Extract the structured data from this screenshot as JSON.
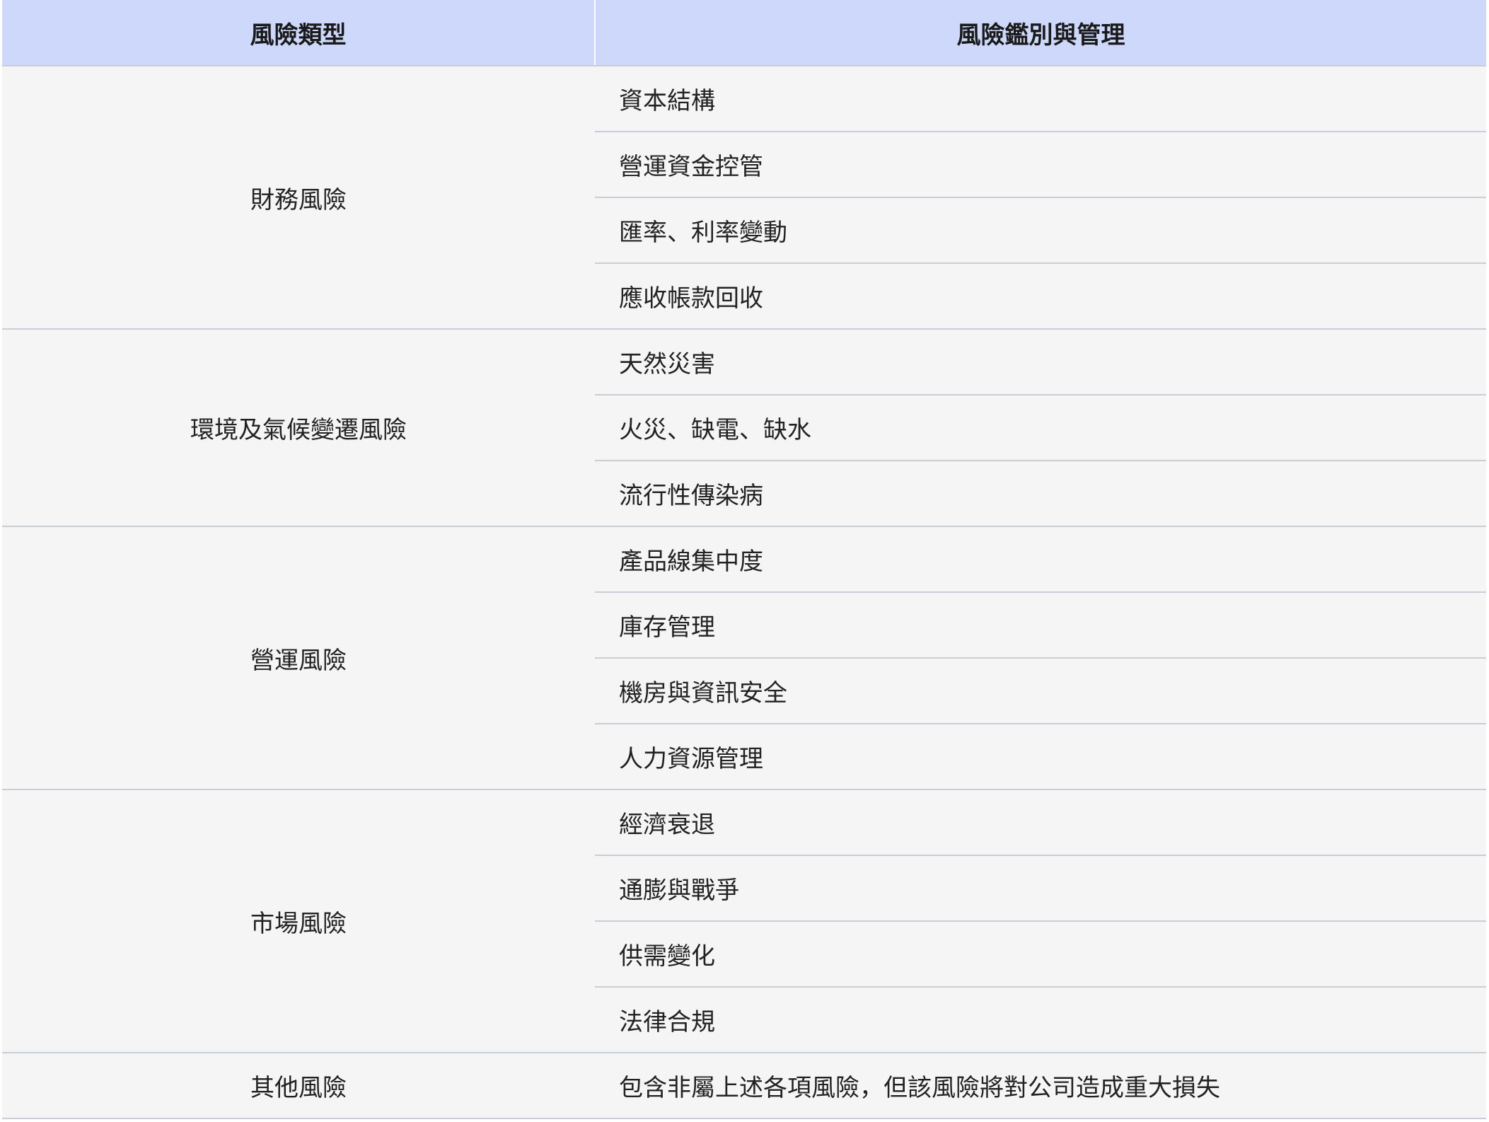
{
  "header": {
    "type_label": "風險類型",
    "management_label": "風險鑑別與管理"
  },
  "groups": [
    {
      "type": "財務風險",
      "items": [
        "資本結構",
        "營運資金控管",
        "匯率、利率變動",
        "應收帳款回收"
      ]
    },
    {
      "type": "環境及氣候變遷風險",
      "items": [
        "天然災害",
        "火災、缺電、缺水",
        "流行性傳染病"
      ]
    },
    {
      "type": "營運風險",
      "items": [
        "產品線集中度",
        "庫存管理",
        "機房與資訊安全",
        "人力資源管理"
      ]
    },
    {
      "type": "市場風險",
      "items": [
        "經濟衰退",
        "通膨與戰爭",
        "供需變化",
        "法律合規"
      ]
    },
    {
      "type": "其他風險",
      "items": [
        "包含非屬上述各項風險，但該風險將對公司造成重大損失"
      ]
    }
  ]
}
